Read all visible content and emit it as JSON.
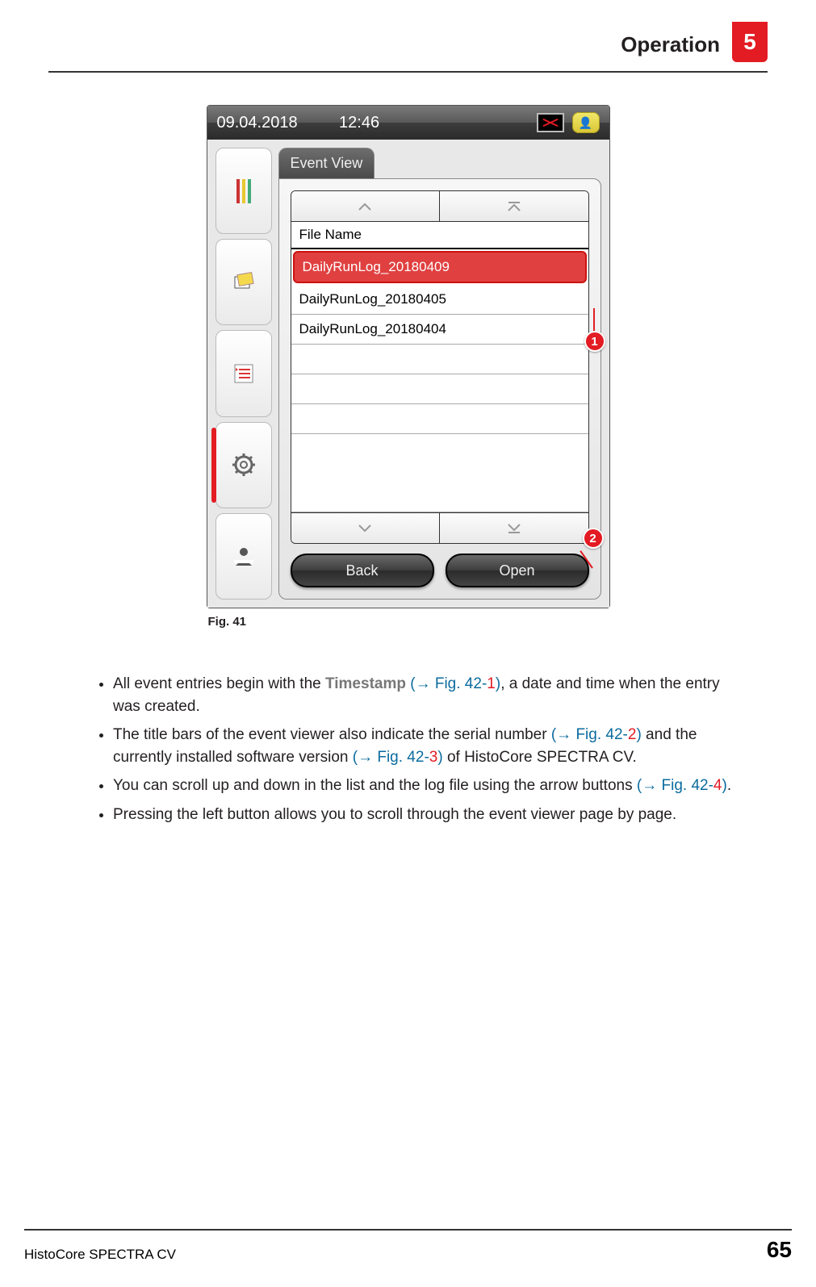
{
  "header": {
    "title": "Operation",
    "chapter": "5"
  },
  "device": {
    "date": "09.04.2018",
    "time": "12:46",
    "panel_title": "Event View",
    "column_header": "File Name",
    "files": [
      "DailyRunLog_20180409",
      "DailyRunLog_20180405",
      "DailyRunLog_20180404"
    ],
    "buttons": {
      "back": "Back",
      "open": "Open"
    },
    "callouts": {
      "c1": "1",
      "c2": "2"
    }
  },
  "figure_caption": "Fig.  41",
  "bullets": {
    "b1_a": "All event entries begin with the ",
    "b1_timestamp": "Timestamp",
    "b1_ref_o": " (",
    "b1_ref": "→ Fig.  42",
    "b1_ref_dash": "-",
    "b1_ref_n": "1",
    "b1_ref_c": ")",
    "b1_b": ", a date and time when the entry was created.",
    "b2_a": "The title bars of the event viewer also indicate the serial number ",
    "b2_ref1_o": "(",
    "b2_ref1": "→ Fig.  42",
    "b2_ref1_dash": "-",
    "b2_ref1_n": "2",
    "b2_ref1_c": ")",
    "b2_b": " and the currently installed software version ",
    "b2_ref2_o": "(",
    "b2_ref2": "→ Fig.  42",
    "b2_ref2_dash": "-",
    "b2_ref2_n": "3",
    "b2_ref2_c": ")",
    "b2_c": " of HistoCore SPECTRA CV.",
    "b3_a": "You can scroll up and down in the list and the log file using the arrow buttons ",
    "b3_ref_o": "(",
    "b3_ref": "→ Fig.  42",
    "b3_ref_dash": "-",
    "b3_ref_n": "4",
    "b3_ref_c": ")",
    "b3_b": ".",
    "b4": "Pressing the left button allows you to scroll through the event viewer page by page."
  },
  "footer": {
    "product": "HistoCore SPECTRA CV",
    "page": "65"
  }
}
